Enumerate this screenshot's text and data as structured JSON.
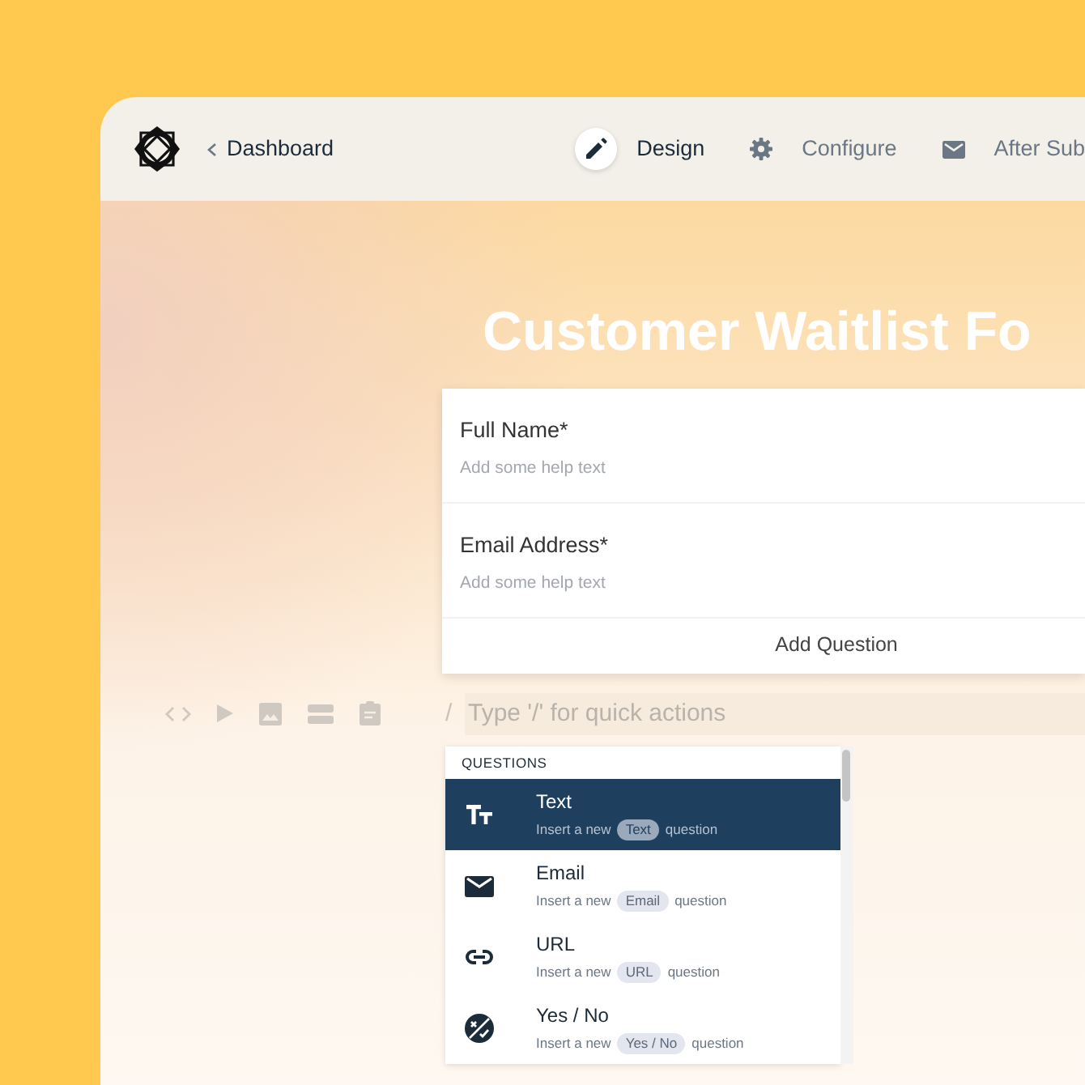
{
  "header": {
    "back_link": "Dashboard",
    "tabs": [
      {
        "label": "Design",
        "selected": true
      },
      {
        "label": "Configure",
        "selected": false
      },
      {
        "label": "After Sub",
        "selected": false
      }
    ]
  },
  "form": {
    "title": "Customer Waitlist Fo",
    "questions": [
      {
        "label": "Full Name*",
        "help": "Add some help text"
      },
      {
        "label": "Email Address*",
        "help": "Add some help text"
      }
    ],
    "add_button": "Add Question"
  },
  "quick_actions": {
    "prefix": "/",
    "placeholder": "Type '/' for quick actions"
  },
  "menu": {
    "section": "QUESTIONS",
    "items": [
      {
        "title": "Text",
        "lead": "Insert a new",
        "tag": "Text",
        "tail": "question",
        "selected": true
      },
      {
        "title": "Email",
        "lead": "Insert a new",
        "tag": "Email",
        "tail": "question",
        "selected": false
      },
      {
        "title": "URL",
        "lead": "Insert a new",
        "tag": "URL",
        "tail": "question",
        "selected": false
      },
      {
        "title": "Yes / No",
        "lead": "Insert a new",
        "tag": "Yes / No",
        "tail": "question",
        "selected": false
      }
    ]
  }
}
